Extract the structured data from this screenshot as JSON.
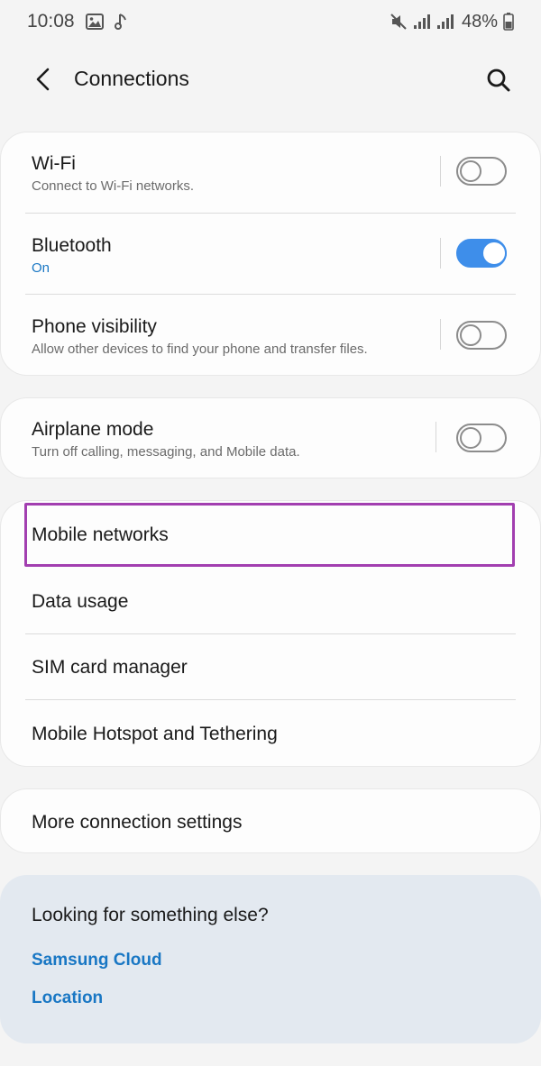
{
  "status_bar": {
    "time": "10:08",
    "battery_percent": "48%",
    "icons": [
      "gallery-icon",
      "music-note-icon",
      "mute-icon",
      "signal-icon",
      "signal-icon",
      "battery-icon"
    ]
  },
  "app_bar": {
    "title": "Connections",
    "back_icon": "back-arrow-icon",
    "search_icon": "search-icon"
  },
  "group1": [
    {
      "title": "Wi-Fi",
      "subtitle": "Connect to Wi-Fi networks.",
      "toggle_on": false
    },
    {
      "title": "Bluetooth",
      "subtitle": "On",
      "toggle_on": true
    },
    {
      "title": "Phone visibility",
      "subtitle": "Allow other devices to find your phone and transfer files.",
      "toggle_on": false
    }
  ],
  "group2": [
    {
      "title": "Airplane mode",
      "subtitle": "Turn off calling, messaging, and Mobile data.",
      "toggle_on": false
    }
  ],
  "group3": [
    {
      "title": "Mobile networks"
    },
    {
      "title": "Data usage"
    },
    {
      "title": "SIM card manager"
    },
    {
      "title": "Mobile Hotspot and Tethering"
    }
  ],
  "group4": [
    {
      "title": "More connection settings"
    }
  ],
  "help": {
    "title": "Looking for something else?",
    "links": [
      "Samsung Cloud",
      "Location"
    ]
  },
  "colors": {
    "accent": "#1977c4",
    "toggle_on": "#3e8eea",
    "highlight": "#a23fb0"
  }
}
